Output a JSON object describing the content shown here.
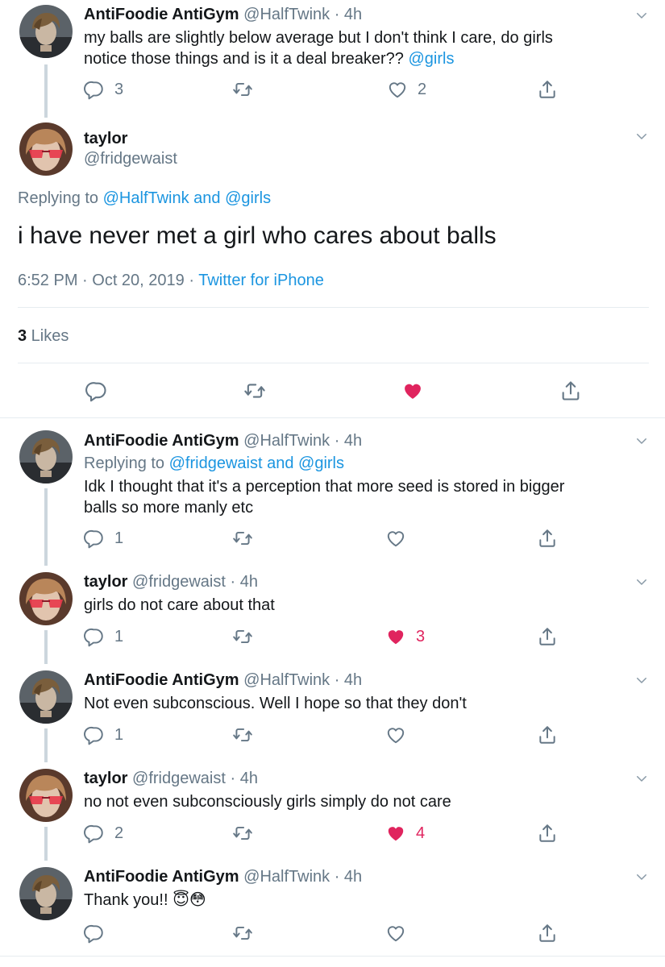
{
  "colors": {
    "accent": "#1b95e0",
    "like": "#e0245e",
    "muted": "#657786"
  },
  "tweet1": {
    "name": "AntiFoodie AntiGym",
    "handle": "@HalfTwink · 4h",
    "text_line1": "my balls are slightly below average but I don't think I care, do girls",
    "text_line2_plain": "notice those things and is it a deal breaker?? ",
    "text_line2_link": "@girls",
    "replies": "3",
    "likes": "2"
  },
  "focus": {
    "name": "taylor",
    "handle": "@fridgewaist",
    "replying_prefix": "Replying to ",
    "replying_user1": "@HalfTwink",
    "replying_and": " and ",
    "replying_user2": "@girls",
    "text": "i have never met a girl who cares about balls",
    "time": "6:52 PM · Oct 20, 2019 · ",
    "source": "Twitter for iPhone",
    "likes_count": "3",
    "likes_label": " Likes"
  },
  "reply1": {
    "name": "AntiFoodie AntiGym",
    "handle": "@HalfTwink · 4h",
    "replying_prefix": "Replying to ",
    "replying_user1": "@fridgewaist",
    "replying_and": " and ",
    "replying_user2": "@girls",
    "text_line1": "Idk I thought that it's a perception that more seed is stored in bigger",
    "text_line2": "balls so more manly etc",
    "replies": "1"
  },
  "reply2": {
    "name": "taylor",
    "handle": "@fridgewaist · 4h",
    "text": "girls do not care about that",
    "replies": "1",
    "likes": "3"
  },
  "reply3": {
    "name": "AntiFoodie AntiGym",
    "handle": "@HalfTwink · 4h",
    "text": "Not even subconscious. Well I hope so that they don't",
    "replies": "1"
  },
  "reply4": {
    "name": "taylor",
    "handle": "@fridgewaist · 4h",
    "text": "no not even subconsciously girls simply do not care",
    "replies": "2",
    "likes": "4"
  },
  "reply5": {
    "name": "AntiFoodie AntiGym",
    "handle": "@HalfTwink · 4h",
    "text": "Thank you!! ",
    "emojis": "😇😳"
  }
}
